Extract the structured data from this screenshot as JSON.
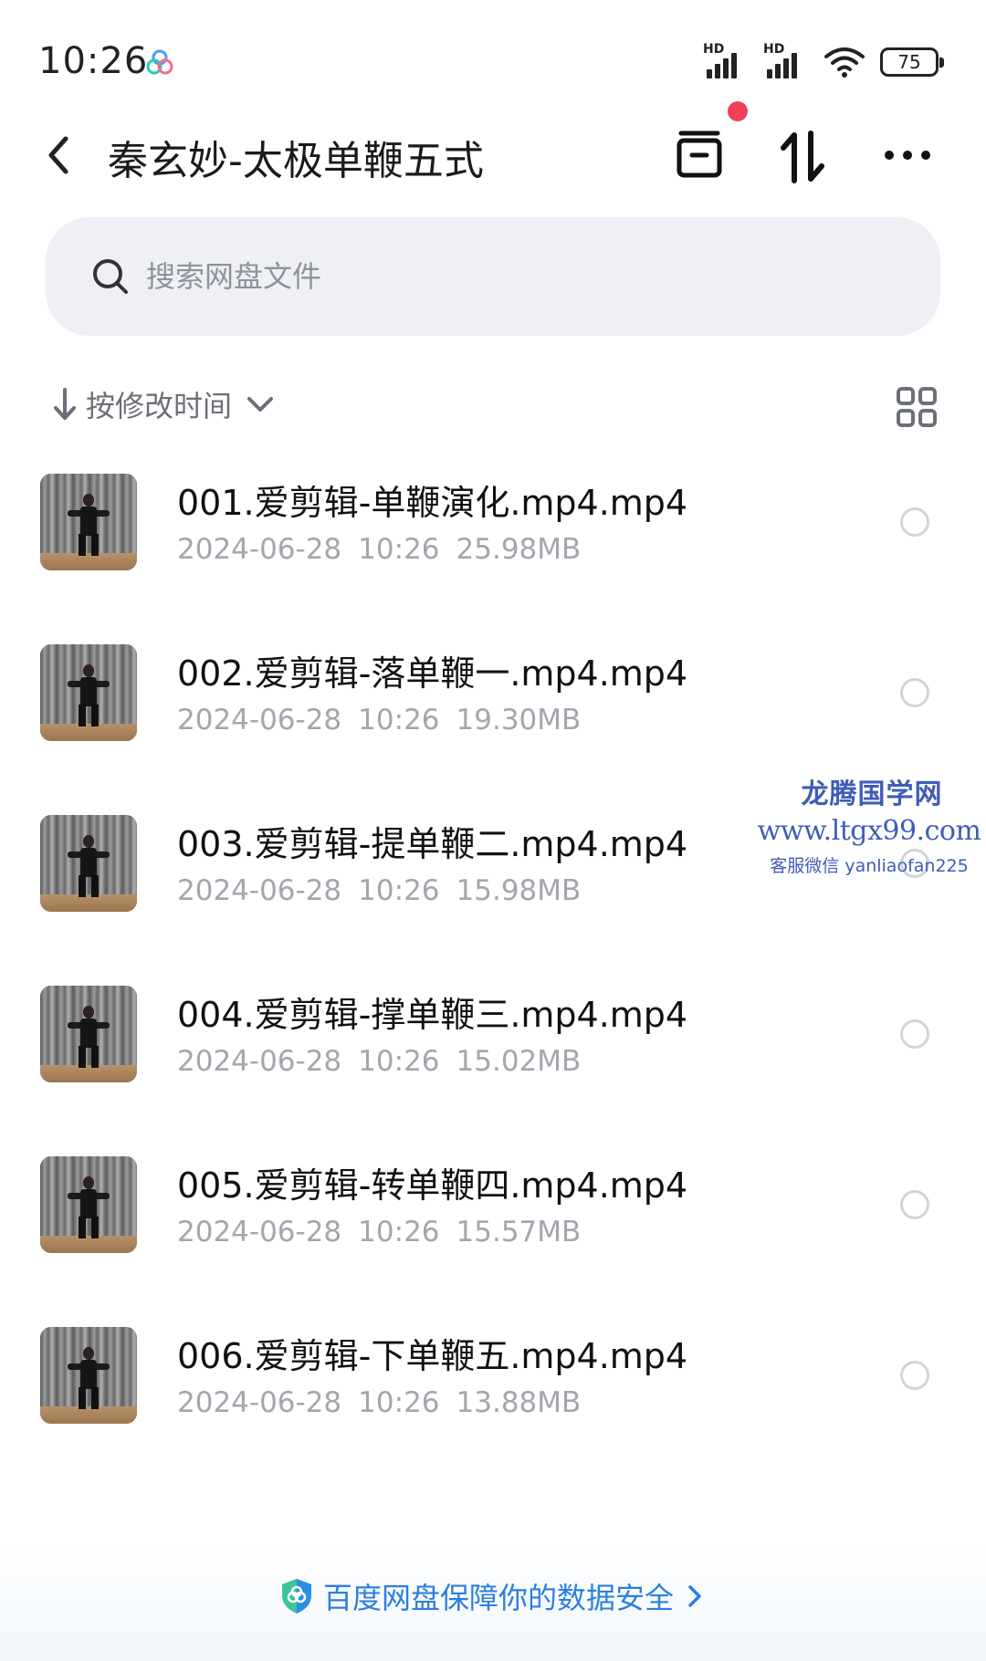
{
  "status_bar": {
    "time": "10:26",
    "network_labels": [
      "HD",
      "HD"
    ],
    "battery": "75"
  },
  "header": {
    "title": "秦玄妙-太极单鞭五式",
    "icons": [
      "back-icon",
      "inbox-icon",
      "sort-icon",
      "more-icon"
    ]
  },
  "search": {
    "placeholder": "搜索网盘文件"
  },
  "sort": {
    "label": "按修改时间"
  },
  "files": [
    {
      "name": "001.爱剪辑-单鞭演化.mp4.mp4",
      "date": "2024-06-28",
      "time": "10:26",
      "size": "25.98MB"
    },
    {
      "name": "002.爱剪辑-落单鞭一.mp4.mp4",
      "date": "2024-06-28",
      "time": "10:26",
      "size": "19.30MB"
    },
    {
      "name": "003.爱剪辑-提单鞭二.mp4.mp4",
      "date": "2024-06-28",
      "time": "10:26",
      "size": "15.98MB"
    },
    {
      "name": "004.爱剪辑-撑单鞭三.mp4.mp4",
      "date": "2024-06-28",
      "time": "10:26",
      "size": "15.02MB"
    },
    {
      "name": "005.爱剪辑-转单鞭四.mp4.mp4",
      "date": "2024-06-28",
      "time": "10:26",
      "size": "15.57MB"
    },
    {
      "name": "006.爱剪辑-下单鞭五.mp4.mp4",
      "date": "2024-06-28",
      "time": "10:26",
      "size": "13.88MB"
    }
  ],
  "watermark": {
    "title": "龙腾国学网",
    "url": "www.ltgx99.com",
    "contact": "客服微信 yanliaofan225"
  },
  "footer": {
    "security_text": "百度网盘保障你的数据安全"
  },
  "colors": {
    "accent_blue": "#2a7fe0",
    "notification_red": "#f0405a",
    "search_bg": "#eef0f5",
    "watermark_blue": "#3f5db8"
  }
}
